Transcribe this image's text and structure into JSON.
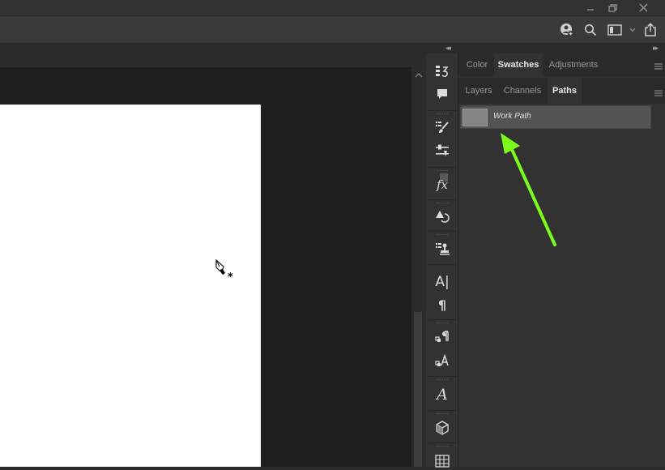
{
  "titlebar": {
    "minimize_icon": "minimize-icon",
    "restore_icon": "restore-icon",
    "close_icon": "close-icon"
  },
  "optionsbar": {
    "icons": [
      "user-add-icon",
      "search-icon",
      "workspace-icon",
      "share-icon"
    ]
  },
  "iconstrip": {
    "icons": [
      "history-icon",
      "comment-icon",
      "brush-settings-icon",
      "adjustments-icon",
      "fx-icon",
      "shape-rotate-icon",
      "clone-source-icon",
      "character-icon",
      "paragraph-icon",
      "paragraph-styles-icon",
      "character-styles-icon",
      "glyphs-icon",
      "3d-cube-icon",
      "grid-icon"
    ],
    "fx_label": "fx",
    "character_label": "A|",
    "paragraph_label": "¶",
    "glyphs_label": "A"
  },
  "top_panel": {
    "tabs": [
      "Color",
      "Swatches",
      "Adjustments"
    ],
    "active_tab": "Swatches"
  },
  "paths_panel": {
    "tabs": [
      "Layers",
      "Channels",
      "Paths"
    ],
    "active_tab": "Paths",
    "path_name": "Work Path"
  },
  "colors": {
    "arrow": "#7cfc1a",
    "canvas": "#ffffff",
    "workspace": "#1e1e1e"
  },
  "cursor": "pen-tool-cursor-icon"
}
